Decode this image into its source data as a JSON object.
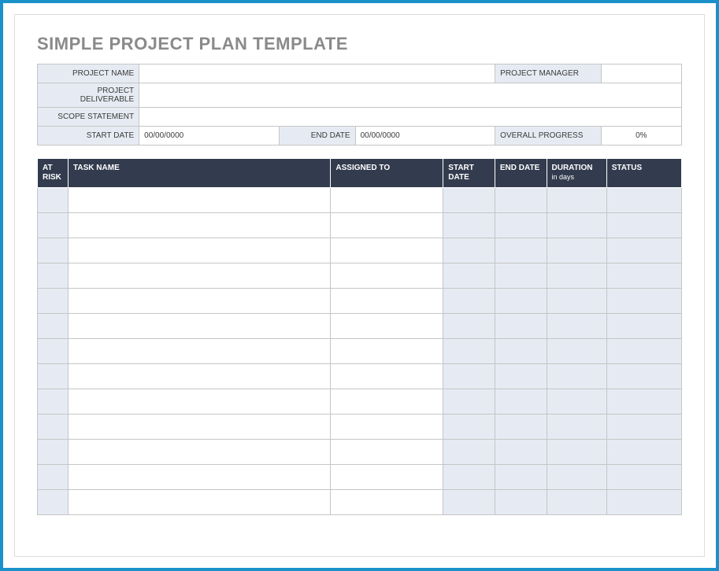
{
  "title": "SIMPLE PROJECT PLAN TEMPLATE",
  "meta": {
    "labels": {
      "project_name": "PROJECT NAME",
      "project_manager": "PROJECT MANAGER",
      "project_deliverable": "PROJECT DELIVERABLE",
      "scope_statement": "SCOPE STATEMENT",
      "start_date": "START DATE",
      "end_date": "END DATE",
      "overall_progress": "OVERALL PROGRESS"
    },
    "values": {
      "project_name": "",
      "project_manager": "",
      "project_deliverable": "",
      "scope_statement": "",
      "start_date": "00/00/0000",
      "end_date": "00/00/0000",
      "overall_progress": "0%"
    }
  },
  "task_table": {
    "headers": {
      "at_risk": "AT RISK",
      "task_name": "TASK NAME",
      "assigned_to": "ASSIGNED TO",
      "start_date": "START DATE",
      "end_date": "END DATE",
      "duration": "DURATION",
      "duration_sub": "in days",
      "status": "STATUS"
    },
    "row_count": 13
  }
}
